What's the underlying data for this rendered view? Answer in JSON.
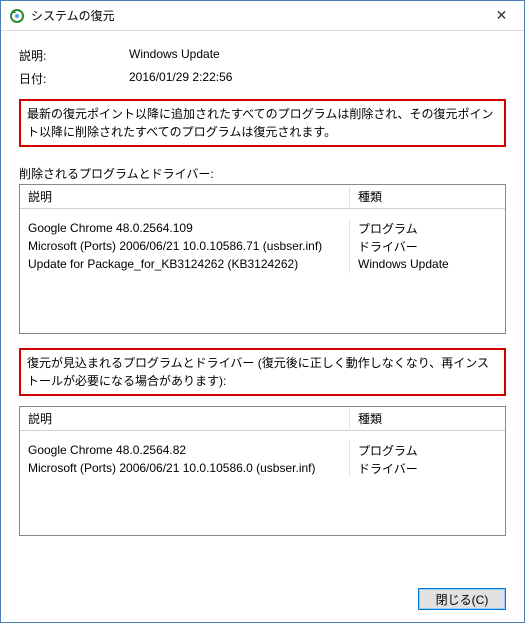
{
  "window": {
    "title": "システムの復元",
    "close_label": "✕"
  },
  "fields": {
    "description_label": "説明:",
    "description_value": "Windows Update",
    "date_label": "日付:",
    "date_value": "2016/01/29 2:22:56"
  },
  "notice1": "最新の復元ポイント以降に追加されたすべてのプログラムは削除され、その復元ポイント以降に削除されたすべてのプログラムは復元されます。",
  "removed": {
    "label": "削除されるプログラムとドライバー:",
    "header_desc": "説明",
    "header_type": "種類",
    "rows": [
      {
        "desc": "Google Chrome 48.0.2564.109",
        "type": "プログラム"
      },
      {
        "desc": "Microsoft (Ports) 2006/06/21 10.0.10586.71 (usbser.inf)",
        "type": "ドライバー"
      },
      {
        "desc": "Update for Package_for_KB3124262 (KB3124262)",
        "type": "Windows Update"
      }
    ]
  },
  "notice2": "復元が見込まれるプログラムとドライバー (復元後に正しく動作しなくなり、再インストールが必要になる場合があります):",
  "restored": {
    "header_desc": "説明",
    "header_type": "種類",
    "rows": [
      {
        "desc": "Google Chrome 48.0.2564.82",
        "type": "プログラム"
      },
      {
        "desc": "Microsoft (Ports) 2006/06/21 10.0.10586.0 (usbser.inf)",
        "type": "ドライバー"
      }
    ]
  },
  "footer": {
    "close_button": "閉じる(C)"
  }
}
